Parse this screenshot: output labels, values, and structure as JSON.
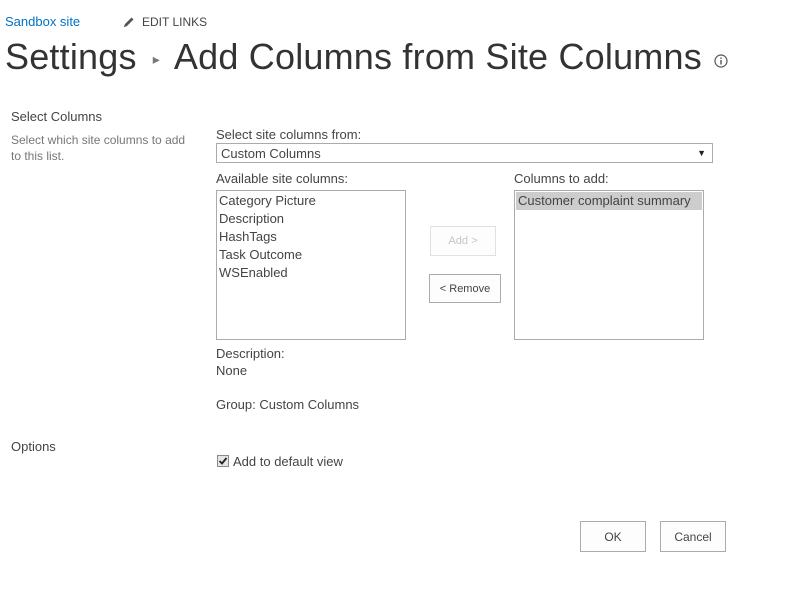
{
  "header": {
    "site_link": "Sandbox site",
    "edit_links": "EDIT LINKS"
  },
  "title": {
    "parent": "Settings",
    "separator": "▸",
    "page": "Add Columns from Site Columns"
  },
  "select_columns": {
    "section_title": "Select Columns",
    "section_desc": "Select which site columns to add to this list.",
    "source_label": "Select site columns from:",
    "source_value": "Custom Columns",
    "available_label": "Available site columns:",
    "available": [
      "Category Picture",
      "Description",
      "HashTags",
      "Task Outcome",
      "WSEnabled"
    ],
    "to_add_label": "Columns to add:",
    "to_add": [
      "Customer complaint summary"
    ],
    "add_button": "Add >",
    "remove_button": "< Remove",
    "description_label": "Description:",
    "description_value": "None",
    "group_text": "Group: Custom Columns"
  },
  "options": {
    "section_title": "Options",
    "add_default_view_label": "Add to default view",
    "add_default_view_checked": true
  },
  "footer": {
    "ok_button": "OK",
    "cancel_button": "Cancel"
  },
  "colors": {
    "link": "#0072c6",
    "selected_bg": "#cdcdcd"
  }
}
